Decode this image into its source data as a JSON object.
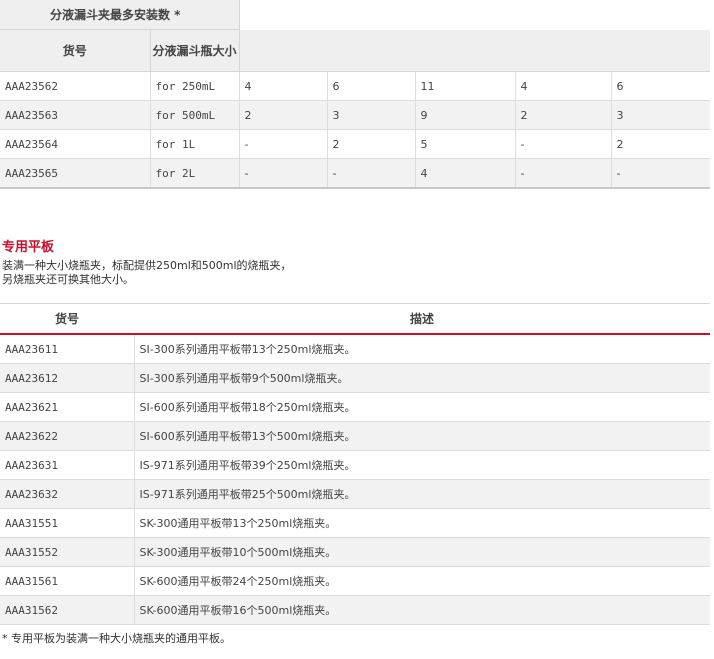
{
  "table1": {
    "header_main": "分液漏斗夹最多安装数 *",
    "col_code": "货号",
    "col_size": "分液漏斗瓶大小",
    "rows": [
      {
        "code": "AAA23562",
        "size": "for 250mL",
        "v": [
          "4",
          "6",
          "11",
          "4",
          "6"
        ]
      },
      {
        "code": "AAA23563",
        "size": "for 500mL",
        "v": [
          "2",
          "3",
          "9",
          "2",
          "3"
        ]
      },
      {
        "code": "AAA23564",
        "size": "for 1L",
        "v": [
          "-",
          "2",
          "5",
          "-",
          "2"
        ]
      },
      {
        "code": "AAA23565",
        "size": "for 2L",
        "v": [
          "-",
          "-",
          "4",
          "-",
          "-"
        ]
      }
    ]
  },
  "section": {
    "title": "专用平板",
    "desc_line1": "装满一种大小烧瓶夹，标配提供250ml和500ml的烧瓶夹，",
    "desc_line2": "另烧瓶夹还可换其他大小。"
  },
  "table2": {
    "col_code": "货号",
    "col_desc": "描述",
    "rows": [
      {
        "code": "AAA23611",
        "desc": "SI-300系列通用平板带13个250ml烧瓶夹。"
      },
      {
        "code": "AAA23612",
        "desc": "SI-300系列通用平板带9个500ml烧瓶夹。"
      },
      {
        "code": "AAA23621",
        "desc": "SI-600系列通用平板带18个250ml烧瓶夹。"
      },
      {
        "code": "AAA23622",
        "desc": "SI-600系列通用平板带13个500ml烧瓶夹。"
      },
      {
        "code": "AAA23631",
        "desc": "IS-971系列通用平板带39个250ml烧瓶夹。"
      },
      {
        "code": "AAA23632",
        "desc": "IS-971系列通用平板带25个500ml烧瓶夹。"
      },
      {
        "code": "AAA31551",
        "desc": "SK-300通用平板带13个250ml烧瓶夹。"
      },
      {
        "code": "AAA31552",
        "desc": "SK-300通用平板带10个500ml烧瓶夹。"
      },
      {
        "code": "AAA31561",
        "desc": "SK-600通用平板带24个250ml烧瓶夹。"
      },
      {
        "code": "AAA31562",
        "desc": "SK-600通用平板带16个500ml烧瓶夹。"
      }
    ]
  },
  "footnote": "* 专用平板为装满一种大小烧瓶夹的通用平板。",
  "colors": {
    "accent": "#c8102e",
    "row_alt": "#f2f2f2",
    "header_bg": "#efefef"
  }
}
